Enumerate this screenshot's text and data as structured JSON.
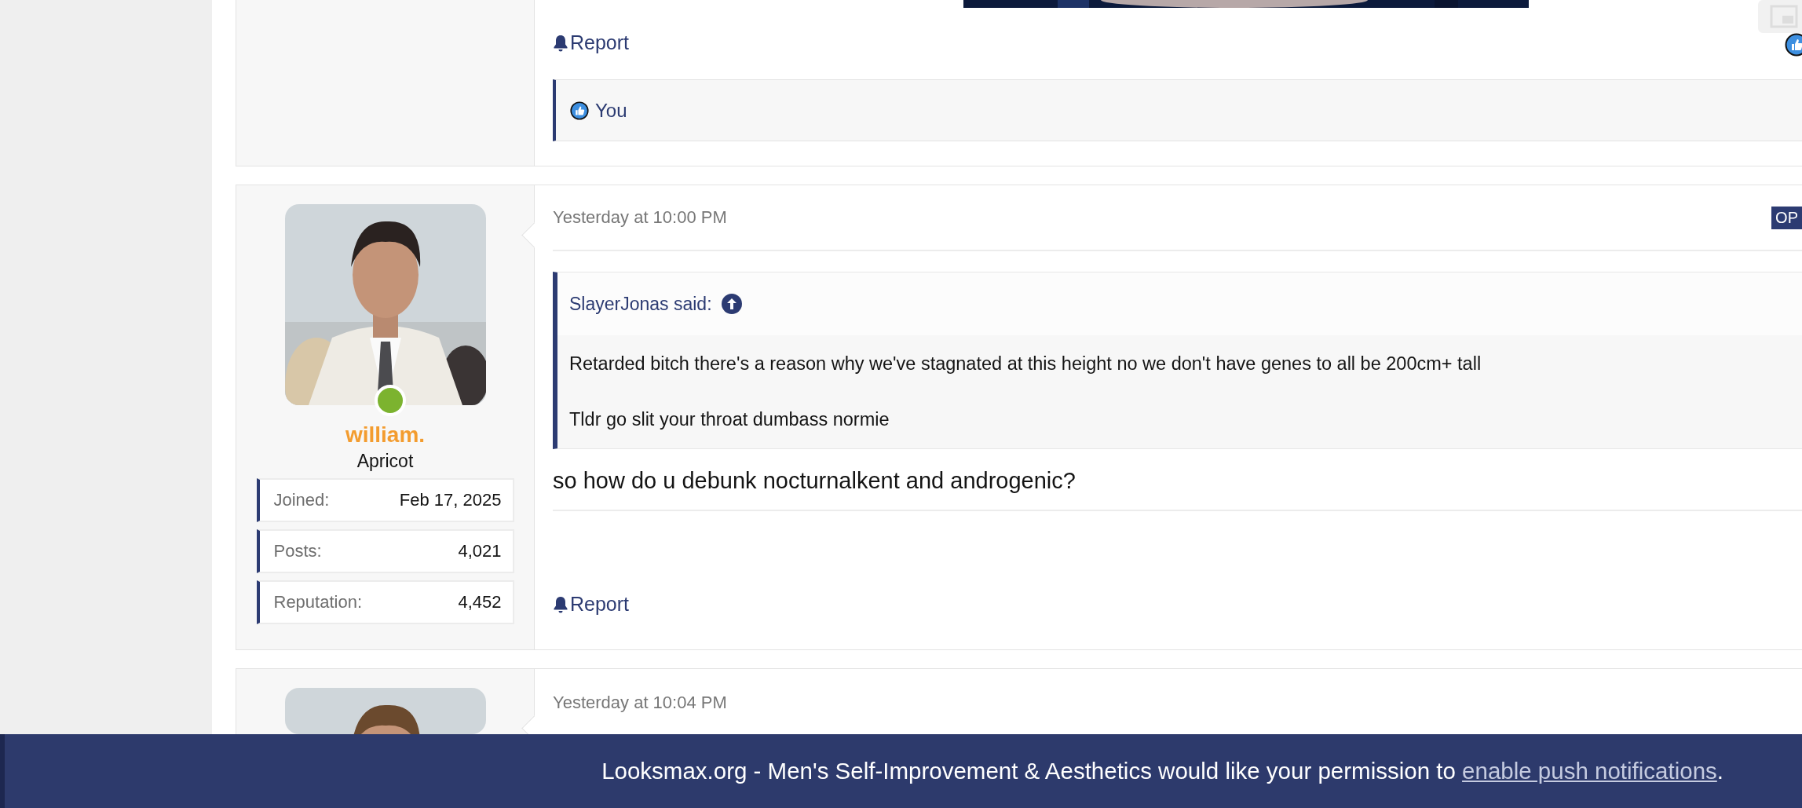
{
  "posts": [
    {
      "kind": "partial-top",
      "has_picture": true,
      "actions": [
        {
          "label": "Report"
        }
      ],
      "reactions": {
        "text": "You"
      }
    },
    {
      "kind": "full",
      "date": "Yesterday at 10:00 PM",
      "badge": "OP",
      "author": {
        "name": "william.",
        "title": "Apricot",
        "online": true,
        "stats": [
          {
            "label": "Joined:",
            "value": "Feb 17, 2025"
          },
          {
            "label": "Posts:",
            "value": "4,021"
          },
          {
            "label": "Reputation:",
            "value": "4,452"
          }
        ]
      },
      "quote": {
        "author": "SlayerJonas said:",
        "lines": [
          "Retarded bitch there's a reason why we've stagnated at this height no we don't have genes to all be 200cm+ tall",
          "Tldr go slit your throat dumbass normie"
        ]
      },
      "body": "so how do u debunk nocturnalkent and androgenic?",
      "actions": [
        {
          "label": "Report"
        }
      ]
    },
    {
      "kind": "partial-bottom",
      "date": "Yesterday at 10:04 PM"
    }
  ],
  "banner": {
    "text": "Looksmax.org - Men's Self-Improvement & Aesthetics would like your permission to ",
    "link": "enable push notifications",
    "suffix": "."
  }
}
